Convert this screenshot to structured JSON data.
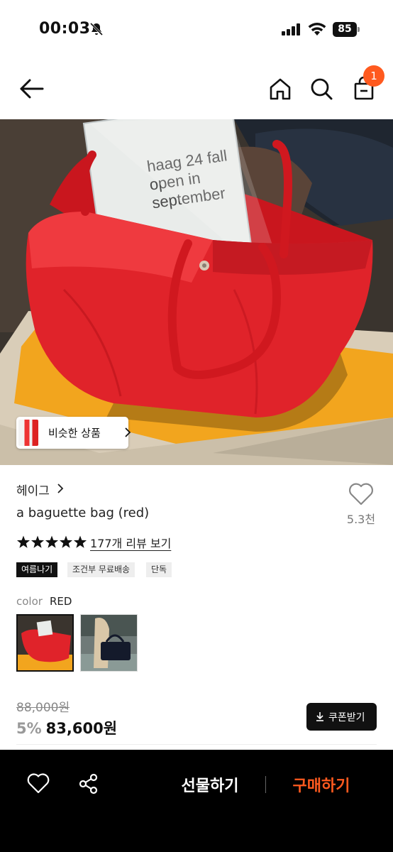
{
  "status_bar": {
    "time": "00:03",
    "battery": "85"
  },
  "nav": {
    "cart_count": "1"
  },
  "hero": {
    "photo_text": [
      "haag 24 fall",
      "open in",
      "september"
    ],
    "similar_label": "비슷한 상품"
  },
  "product": {
    "brand": "헤이그",
    "name": "a baguette bag (red)",
    "wish_count": "5.3천",
    "rating_stars": 5,
    "review_link": "177개 리뷰 보기",
    "tags": [
      "여름나기",
      "조건부 무료배송",
      "단독"
    ],
    "color_label": "color",
    "color_value": "RED",
    "original_price": "88,000원",
    "discount": "5%",
    "price": "83,600원",
    "coupon_label": "쿠폰받기"
  },
  "bottom_bar": {
    "gift_label": "선물하기",
    "buy_label": "구매하기"
  },
  "colors": {
    "accent": "#ff5a1f",
    "bag_red": "#e0232a"
  }
}
